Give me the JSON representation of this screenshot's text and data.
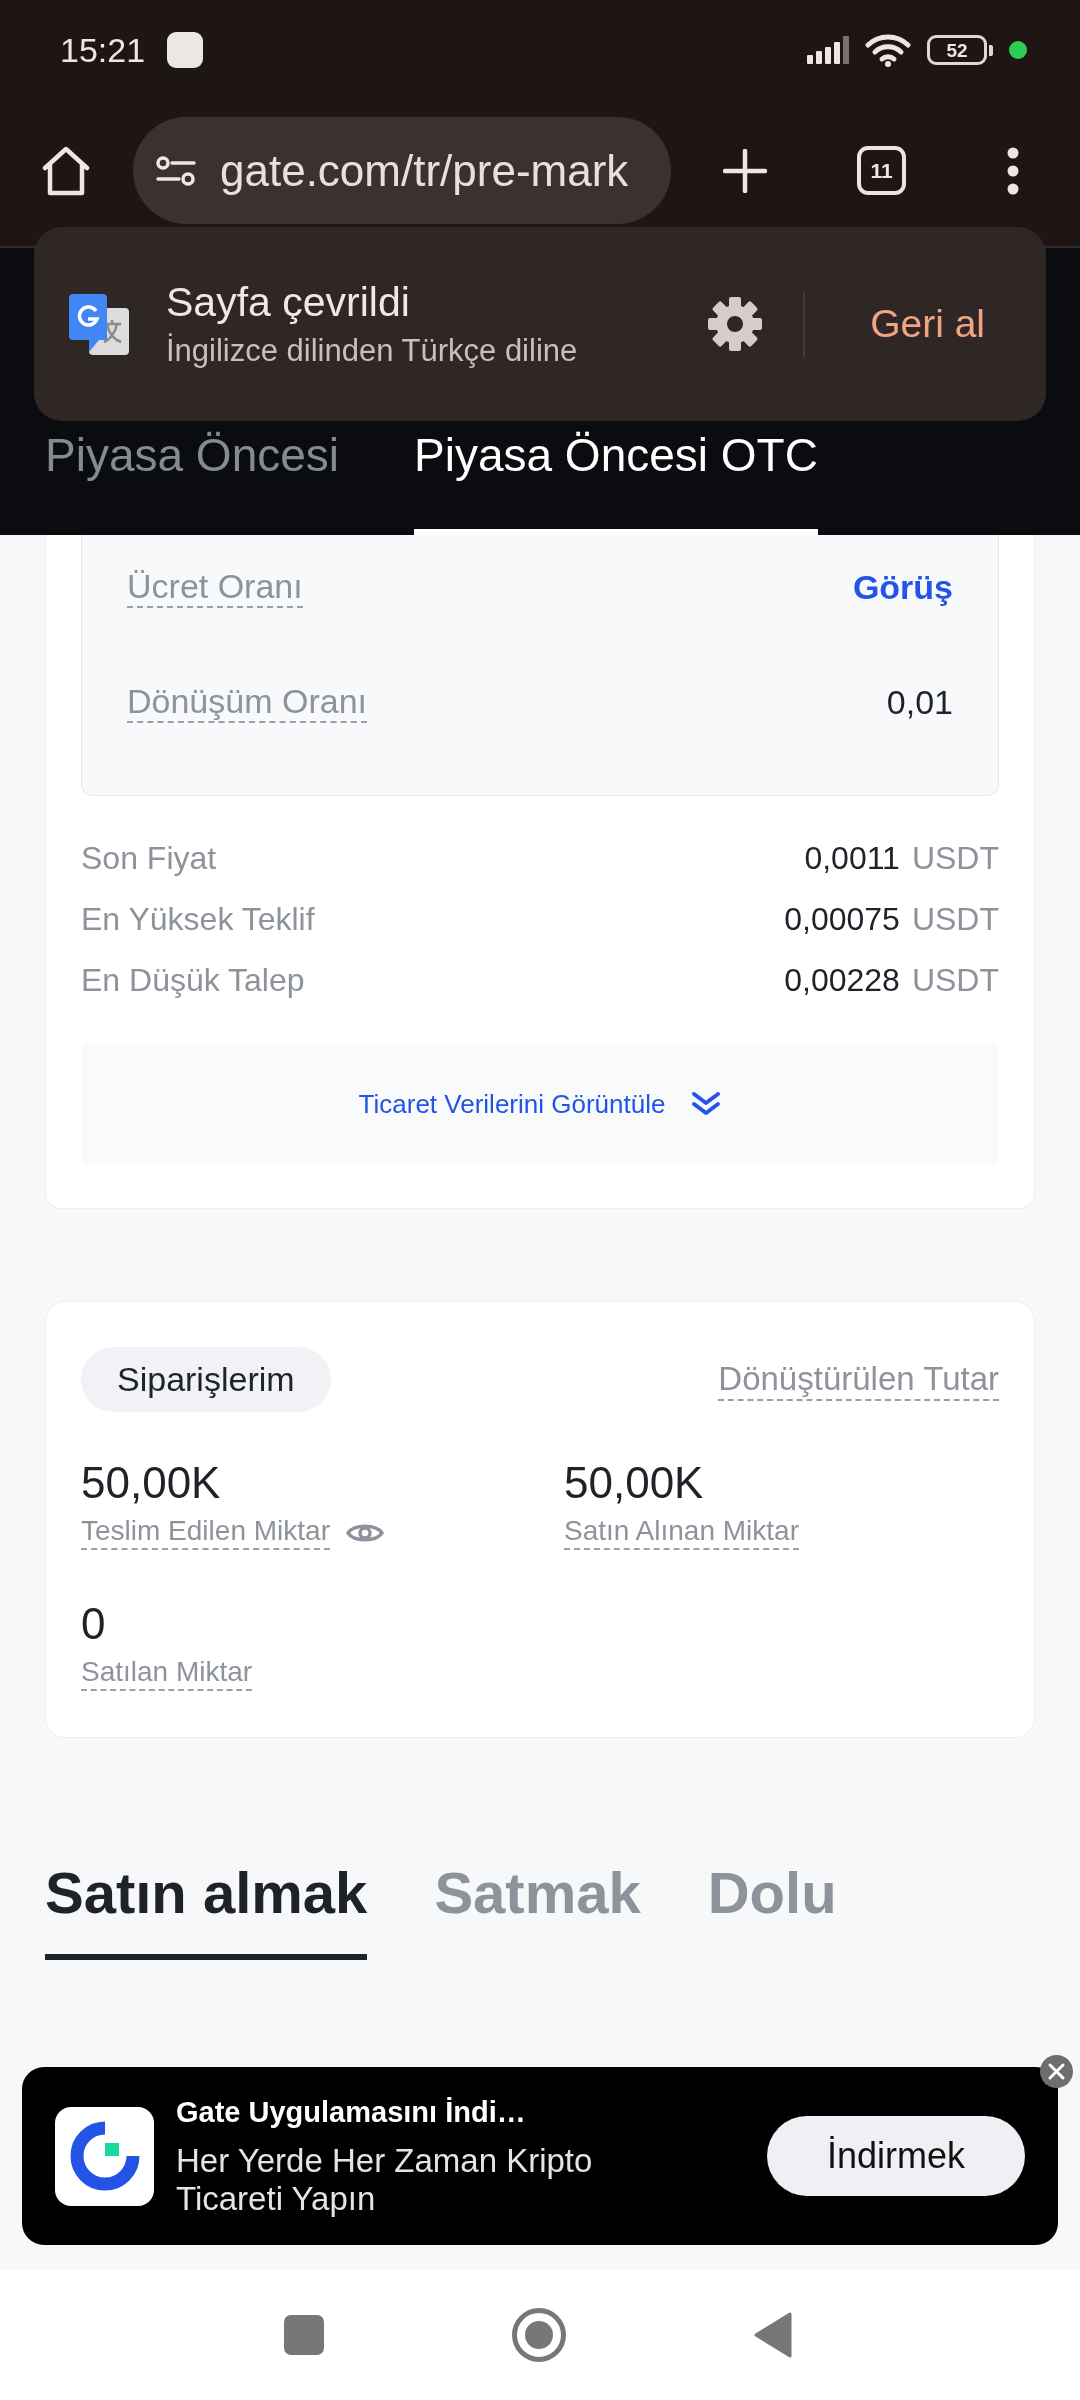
{
  "status_bar": {
    "time": "15:21",
    "battery": "52"
  },
  "browser_toolbar": {
    "url": "gate.com/tr/pre-mark",
    "tab_count": "11"
  },
  "translate_popup": {
    "title": "Sayfa çevrildi",
    "subtitle": "İngilizce dilinden Türkçe diline",
    "action": "Geri al"
  },
  "market_tabs": [
    {
      "label": "Piyasa Öncesi",
      "selected": false
    },
    {
      "label": "Piyasa Öncesi OTC",
      "selected": true
    }
  ],
  "price_card": {
    "rates": [
      {
        "label": "Ücret Oranı",
        "value": "Görüş",
        "kind": "link"
      },
      {
        "label": "Dönüşüm Oranı",
        "value": "0,01",
        "kind": "text"
      }
    ],
    "prices": [
      {
        "label": "Son Fiyat",
        "value": "0,0011",
        "unit": "USDT"
      },
      {
        "label": "En Yüksek Teklif",
        "value": "0,00075",
        "unit": "USDT"
      },
      {
        "label": "En Düşük Talep",
        "value": "0,00228",
        "unit": "USDT"
      }
    ],
    "trade_data_button": "Ticaret Verilerini Görüntüle"
  },
  "orders_card": {
    "tab": "Siparişlerim",
    "converted_amount_label": "Dönüştürülen Tutar",
    "stats": [
      {
        "value": "50,00K",
        "label": "Teslim Edilen Miktar",
        "visibility_toggle": true
      },
      {
        "value": "50,00K",
        "label": "Satın Alınan Miktar",
        "visibility_toggle": false
      },
      {
        "value": "0",
        "label": "Satılan Miktar",
        "visibility_toggle": false
      }
    ]
  },
  "trade_tabs": [
    {
      "label": "Satın almak",
      "selected": true
    },
    {
      "label": "Satmak",
      "selected": false
    },
    {
      "label": "Dolu",
      "selected": false
    }
  ],
  "app_banner": {
    "title": "Gate Uygulamasını İndi…",
    "subtitle": "Her Yerde Her Zaman Kripto Ticareti Yapın",
    "button": "İndirmek"
  }
}
